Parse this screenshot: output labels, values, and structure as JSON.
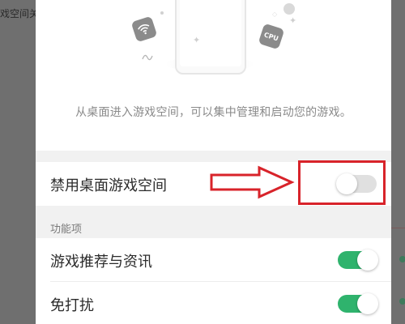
{
  "background": {
    "left_text": "戏空间关"
  },
  "hero": {
    "description": "从桌面进入游戏空间，可以集中管理和启动您的游戏。",
    "chip_cpu_label": "CPU"
  },
  "settings": {
    "disable_desktop_game_space": {
      "label": "禁用桌面游戏空间",
      "enabled": false
    },
    "section_title": "功能项",
    "items": [
      {
        "label": "游戏推荐与资讯",
        "enabled": true
      },
      {
        "label": "免打扰",
        "enabled": true
      }
    ]
  },
  "colors": {
    "toggle_on": "#2fb36d",
    "toggle_off": "#e0e0e0",
    "annotation_red": "#d8232a",
    "sheet_bg": "#ffffff",
    "section_bg": "#f1f1f1"
  },
  "icons": [
    "wifi-icon",
    "cpu-icon",
    "phone-illustration",
    "sparkle-icon",
    "arrow-annotation"
  ]
}
